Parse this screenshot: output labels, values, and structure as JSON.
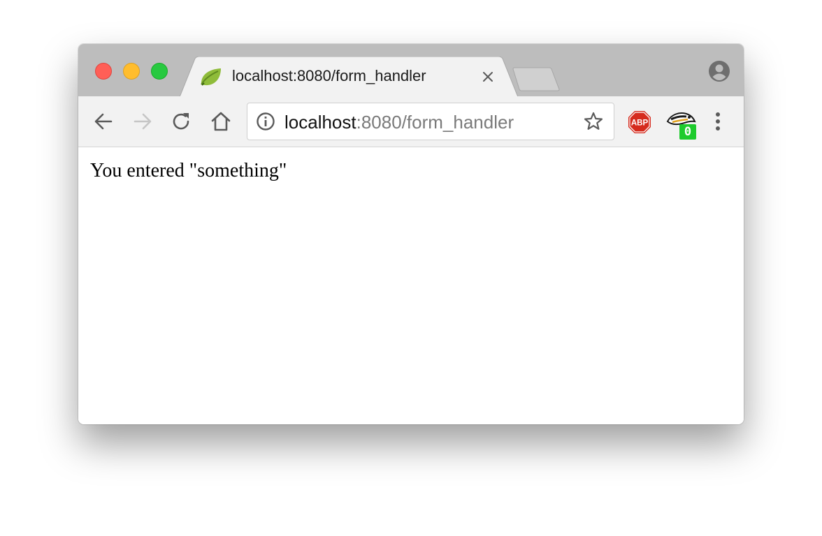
{
  "window": {
    "controls": {
      "close": "close-icon",
      "minimize": "minimize-icon",
      "zoom": "zoom-icon",
      "colors": {
        "close": "#ff5f57",
        "minimize": "#ffbd2e",
        "zoom": "#28c940"
      }
    }
  },
  "tab": {
    "favicon": "spring-leaf-icon",
    "title": "localhost:8080/form_handler",
    "close_icon": "close-icon"
  },
  "toolbar": {
    "back_icon": "back-arrow-icon",
    "forward_icon": "forward-arrow-icon",
    "reload_icon": "reload-icon",
    "home_icon": "home-icon",
    "address": {
      "host": "localhost",
      "path": ":8080/form_handler",
      "info_icon": "info-icon",
      "star_icon": "star-icon"
    },
    "extensions": {
      "abp": {
        "icon": "adblock-plus-icon",
        "label": "ABP",
        "color": "#d52b1e"
      },
      "privacy_badger": {
        "icon": "privacy-badger-icon",
        "badge": "0",
        "badge_color": "#1ecb2d"
      }
    },
    "menu_icon": "more-vert-icon"
  },
  "page": {
    "text": "You entered \"something\""
  }
}
